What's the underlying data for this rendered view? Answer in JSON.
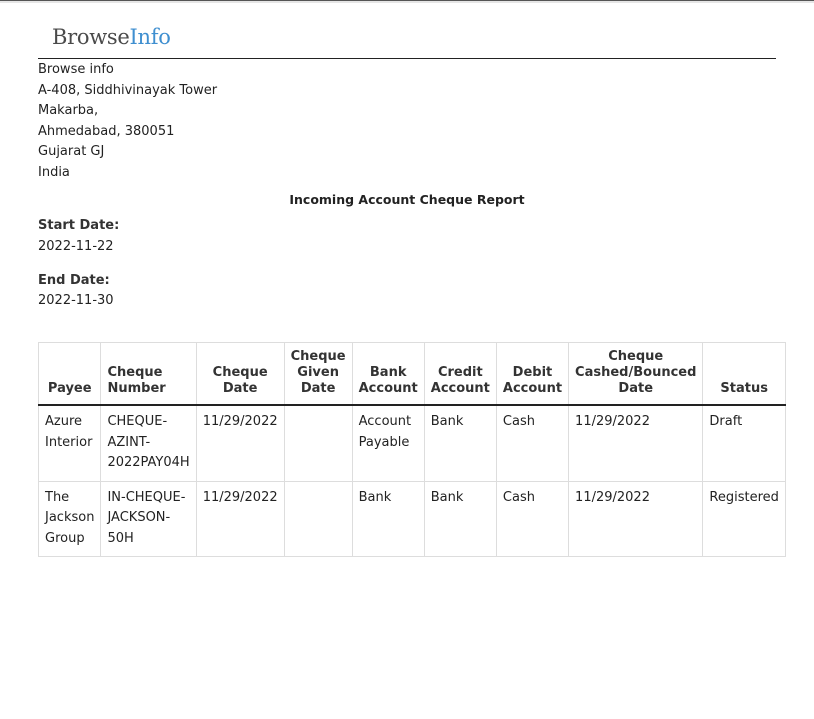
{
  "logo": {
    "part1": "Browse",
    "part2": "Info",
    "colors": {
      "part1": "#4a4a4a",
      "part2": "#3f8fd0"
    }
  },
  "address": [
    "Browse info",
    "A-408, Siddhivinayak Tower",
    "Makarba,",
    "Ahmedabad, 380051",
    "Gujarat GJ",
    "India"
  ],
  "report": {
    "title": "Incoming Account Cheque Report",
    "start_label": "Start Date:",
    "start_value": "2022-11-22",
    "end_label": "End Date:",
    "end_value": "2022-11-30"
  },
  "table": {
    "headers": {
      "payee": "Payee",
      "cheque_number": "Cheque Number",
      "cheque_date": [
        "Cheque",
        "Date"
      ],
      "given_date": [
        "Cheque",
        "Given",
        "Date"
      ],
      "bank_account": [
        "Bank",
        "Account"
      ],
      "credit_account": [
        "Credit",
        "Account"
      ],
      "debit_account": [
        "Debit",
        "Account"
      ],
      "cashed_date": [
        "Cheque",
        "Cashed/Bounced",
        "Date"
      ],
      "status": "Status"
    },
    "rows": [
      {
        "payee": [
          "Azure",
          "Interior"
        ],
        "cheque_number": [
          "CHEQUE-",
          "AZINT-",
          "2022PAY04H"
        ],
        "cheque_date": "11/29/2022",
        "given_date": "",
        "bank_account": [
          "Account",
          "Payable"
        ],
        "credit_account": "Bank",
        "debit_account": "Cash",
        "cashed_date": "11/29/2022",
        "status": "Draft"
      },
      {
        "payee": [
          "The",
          "Jackson",
          "Group"
        ],
        "cheque_number": [
          "IN-CHEQUE-",
          "JACKSON-50H"
        ],
        "cheque_date": "11/29/2022",
        "given_date": "",
        "bank_account": [
          "Bank"
        ],
        "credit_account": "Bank",
        "debit_account": "Cash",
        "cashed_date": "11/29/2022",
        "status": "Registered"
      }
    ]
  }
}
